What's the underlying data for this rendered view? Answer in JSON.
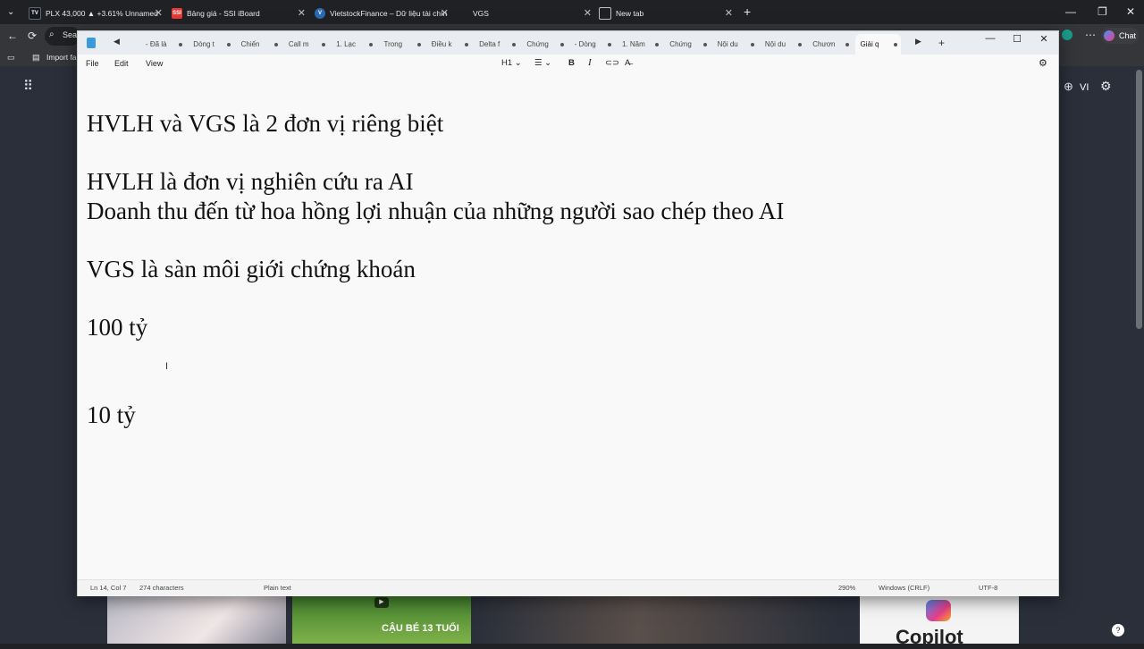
{
  "browser": {
    "tabs": [
      {
        "title": "PLX 43,000 ▲ +3.61% Unnamed",
        "icon": "tradingview-icon",
        "color": "#131722",
        "glyph": "TV"
      },
      {
        "title": "Bảng giá - SSI iBoard",
        "icon": "ssi-icon",
        "color": "#e53935",
        "glyph": "SSI"
      },
      {
        "title": "VietstockFinance – Dữ liệu tài chín",
        "icon": "vietstock-icon",
        "color": "#2b6cb0",
        "glyph": "V"
      },
      {
        "title": "VGS",
        "icon": "page-icon",
        "color": "#5f6368",
        "glyph": ""
      },
      {
        "title": "New tab",
        "icon": "newtab-icon",
        "color": "#5f6368",
        "glyph": ""
      }
    ],
    "address_text": "Sea",
    "bookmark_label": "Import fa",
    "language_label": "VI",
    "chat_label": "Chat",
    "thumb_caption": "CẬU BÉ 13 TUỔI",
    "copilot_text": "Copilot"
  },
  "notepad": {
    "tabs": [
      "- Đã là",
      "Dòng t",
      "Chiến",
      "Call m",
      "1. Lạc",
      "Trong",
      "Điều k",
      "Delta f",
      "Chứng",
      "- Dòng",
      "1. Năm",
      "Chứng",
      "Nội du",
      "Nội du",
      "Chươn",
      "Giải q"
    ],
    "active_tab_index": 15,
    "menu": {
      "file": "File",
      "edit": "Edit",
      "view": "View"
    },
    "format": {
      "heading": "H1"
    },
    "lines": [
      "HVLH và VGS là 2 đơn vị riêng biệt",
      "HVLH là đơn vị nghiên cứu ra AI",
      "Doanh thu đến từ hoa hồng lợi nhuận của những người sao chép theo AI",
      "VGS là sàn môi giới chứng khoán",
      "100 tỷ",
      "10 tỷ"
    ],
    "status": {
      "position": "Ln 14, Col 7",
      "characters": "274 characters",
      "format": "Plain text",
      "zoom": "290%",
      "line_ending": "Windows (CRLF)",
      "encoding": "UTF-8"
    }
  }
}
